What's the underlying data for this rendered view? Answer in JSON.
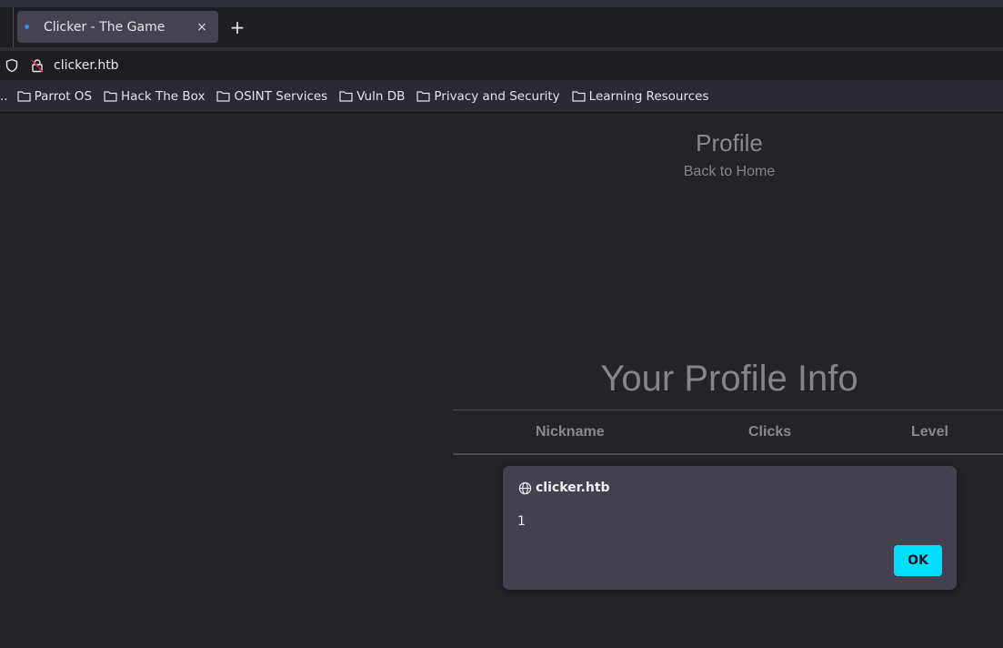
{
  "browser": {
    "tab": {
      "title": "Clicker - The Game",
      "close_glyph": "×"
    },
    "new_tab_glyph": "+",
    "url": "clicker.htb",
    "bookmarks_overflow": "..",
    "bookmarks": [
      {
        "label": "Parrot OS",
        "icon": "folder-icon"
      },
      {
        "label": "Hack The Box",
        "icon": "folder-icon"
      },
      {
        "label": "OSINT Services",
        "icon": "folder-icon"
      },
      {
        "label": "Vuln DB",
        "icon": "folder-icon"
      },
      {
        "label": "Privacy and Security",
        "icon": "folder-icon"
      },
      {
        "label": "Learning Resources",
        "icon": "folder-icon"
      }
    ]
  },
  "page": {
    "title": "Profile",
    "back_link": "Back to Home",
    "info_heading": "Your Profile Info",
    "table": {
      "columns": [
        "Nickname",
        "Clicks",
        "Level"
      ]
    }
  },
  "alert": {
    "origin": "clicker.htb",
    "message": "1",
    "ok_label": "OK",
    "accent_color": "#00ddff"
  }
}
